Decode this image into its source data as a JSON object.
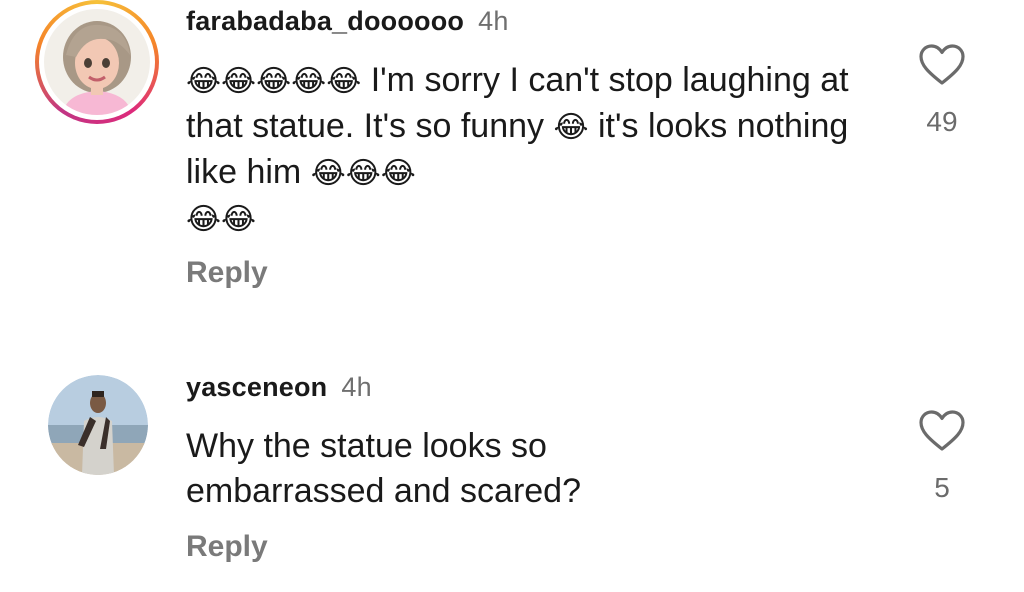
{
  "comments": [
    {
      "username": "farabadaba_doooooo",
      "time": "4h",
      "emoji_lead": "😂😂😂😂😂",
      "text_main": "I'm sorry I can't stop laughing at that statue. It's so funny",
      "emoji_mid": "😂",
      "text_after": "it's looks nothing like him",
      "emoji_trail": "😂😂😂",
      "emoji_end": "😂😂",
      "reply_label": "Reply",
      "like_count": "49",
      "avatar_icon": "memoji-avatar"
    },
    {
      "username": "yasceneon",
      "time": "4h",
      "text": "Why the statue looks so embarrassed and scared?",
      "reply_label": "Reply",
      "like_count": "5",
      "avatar_icon": "photo-avatar"
    }
  ],
  "colors": {
    "story_ring": [
      "#f6c23a",
      "#f58529",
      "#dd2a7b",
      "#c13584"
    ],
    "username": "#1a1a1a",
    "muted": "#6f6f6f",
    "reply": "#7a7a7a"
  }
}
